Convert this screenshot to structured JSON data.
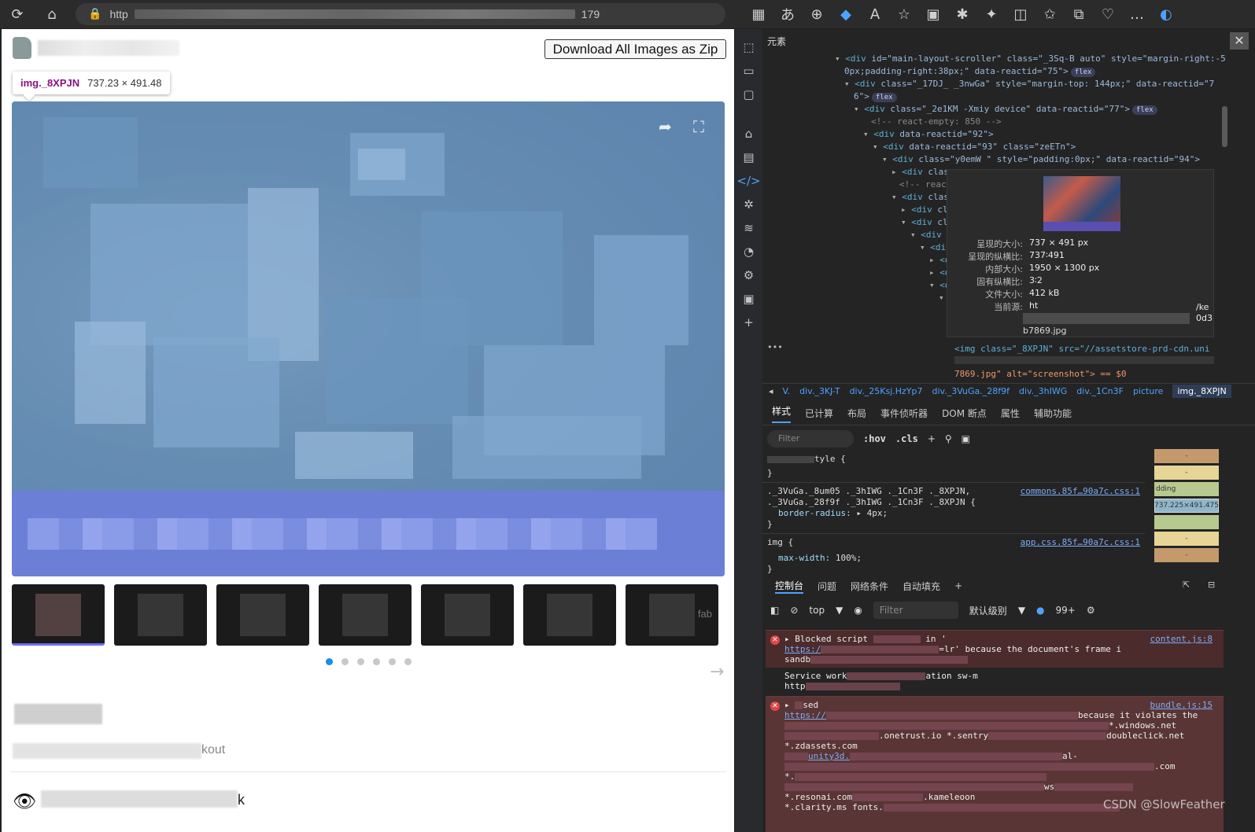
{
  "browser": {
    "address_suffix": "179",
    "address_prefix": "http"
  },
  "page": {
    "download_button": "Download All Images as Zip",
    "tooltip_tag": "img._8XPJN",
    "tooltip_size": "737.23 × 491.48",
    "thumb_fab_text": "fab",
    "subtitle_end": "kout",
    "views_end": "k"
  },
  "devtools": {
    "panel_title": "元素",
    "dom_lines": [
      {
        "indent": 92,
        "arrow": "▾",
        "tag": "div",
        "attrs": "id=\"main-layout-scroller\" class=\"_3Sq-B auto\" style=\"margin-right:-5",
        "badge": ""
      },
      {
        "indent": 104,
        "arrow": "",
        "tag": "",
        "attrs": "0px;padding-right:38px;\" data-reactid=\"75\">",
        "badge": "flex"
      },
      {
        "indent": 104,
        "arrow": "▾",
        "tag": "div",
        "attrs": "class=\"_17DJ_ _3nwGa\" style=\"margin-top: 144px;\" data-reactid=\"7",
        "badge": ""
      },
      {
        "indent": 116,
        "arrow": "",
        "tag": "",
        "attrs": "6\">",
        "badge": "flex"
      },
      {
        "indent": 116,
        "arrow": "▾",
        "tag": "div",
        "attrs": "class=\"_2e1KM -Xmiy device\" data-reactid=\"77\">",
        "badge": "flex"
      },
      {
        "indent": 138,
        "arrow": "",
        "tag": "",
        "attrs": "<!-- react-empty: 850 -->",
        "badge": ""
      },
      {
        "indent": 128,
        "arrow": "▾",
        "tag": "div",
        "attrs": "data-reactid=\"92\">",
        "badge": ""
      },
      {
        "indent": 140,
        "arrow": "▾",
        "tag": "div",
        "attrs": "data-reactid=\"93\" class=\"zeETn\">",
        "badge": ""
      },
      {
        "indent": 152,
        "arrow": "▾",
        "tag": "div",
        "attrs": "class=\"y0emW \" style=\"padding:0px;\" data-reactid=\"94\">",
        "badge": ""
      },
      {
        "indent": 164,
        "arrow": "▸",
        "tag": "div",
        "attrs": "clas",
        "badge": ""
      },
      {
        "indent": 174,
        "arrow": "",
        "tag": "",
        "attrs": "<!-- react",
        "badge": ""
      },
      {
        "indent": 164,
        "arrow": "▾",
        "tag": "div",
        "attrs": "clas",
        "badge": ""
      },
      {
        "indent": 176,
        "arrow": "▸",
        "tag": "div",
        "attrs": "cl",
        "badge": ""
      },
      {
        "indent": 176,
        "arrow": "▾",
        "tag": "div",
        "attrs": "cl",
        "badge": ""
      },
      {
        "indent": 188,
        "arrow": "▾",
        "tag": "div",
        "attrs": "",
        "badge": ""
      },
      {
        "indent": 200,
        "arrow": "▾",
        "tag": "div",
        "attrs": "",
        "badge": ""
      },
      {
        "indent": 212,
        "arrow": "▸",
        "tag": "d",
        "attrs": "",
        "badge": ""
      },
      {
        "indent": 212,
        "arrow": "▸",
        "tag": "d",
        "attrs": "",
        "badge": ""
      },
      {
        "indent": 212,
        "arrow": "▾",
        "tag": "d",
        "attrs": "",
        "badge": ""
      },
      {
        "indent": 224,
        "arrow": "▾",
        "tag": "",
        "attrs": "",
        "badge": ""
      }
    ],
    "img_line_1": "<img class=\"_8XPJN\" src=\"//assetstore-prd-cdn.uni",
    "img_line_3": "7869.jpg\" alt=\"screenshot\"> == $0",
    "img_tooltip": {
      "rows": [
        {
          "k": "呈现的大小:",
          "v": "737 × 491 px"
        },
        {
          "k": "呈现的纵横比:",
          "v": "737∶491"
        },
        {
          "k": "内部大小:",
          "v": "1950 × 1300 px"
        },
        {
          "k": "固有纵横比:",
          "v": "3∶2"
        },
        {
          "k": "文件大小:",
          "v": "412 kB"
        },
        {
          "k": "当前源:",
          "v": "ht"
        }
      ],
      "src_tail": "b7869.jpg",
      "src_end_1": "/ke",
      "src_end_2": "0d3"
    },
    "breadcrumbs": [
      "V.",
      "div._3KJ-T",
      "div._25Ksj.HzYp7",
      "div._3VuGa._28f9f",
      "div._3hIWG",
      "div._1Cn3F",
      "picture",
      "img._8XPJN"
    ],
    "tabs": [
      "样式",
      "已计算",
      "布局",
      "事件侦听器",
      "DOM 断点",
      "属性",
      "辅助功能"
    ],
    "styles_filter_placeholder": "Filter",
    "hov": ":hov",
    "cls": ".cls",
    "styles": {
      "rule1_tail": "tyle {",
      "rule1_close": "}",
      "rule2_sel1": "._3VuGa._8um05 ._3hIWG ._1Cn3F ._8XPJN,",
      "rule2_sel2": "._3VuGa._28f9f ._3hIWG ._1Cn3F ._8XPJN {",
      "rule2_prop": "border-radius:",
      "rule2_val": "▸ 4px;",
      "rule2_src": "commons.85f…90a7c.css:1",
      "rule3_sel": "img {",
      "rule3_prop": "max-width:",
      "rule3_val": "100%;",
      "rule3_src": "app.css.85f…90a7c.css:1"
    },
    "box_model": {
      "margin": "-",
      "border": "-",
      "padding": "dding",
      "content": "737.225×491.475"
    },
    "console_tabs": [
      "控制台",
      "问题",
      "网络条件",
      "自动填充"
    ],
    "console_top": "top",
    "console_filter": "Filter",
    "console_level": "默认级别",
    "console_count": "99+",
    "errors": [
      {
        "text": "Blocked script",
        "mid": "in '",
        "end": "=lr' because the document's frame i",
        "link": "https:/",
        "src": "content.js:8",
        "line3": "sandb"
      },
      {
        "text": "Service work",
        "mid": "ation sw-m",
        "end": "",
        "link": "http",
        "src": "",
        "line3": ""
      }
    ],
    "error2": {
      "head": "sed",
      "src": "bundle.js:15",
      "link": "https://",
      "l1": "because it violates the",
      "l2": "*.windows.net",
      "l3": "doubleclick.net",
      "l4": ".onetrust.io *.sentry",
      "l5": "*.zdassets.com",
      "l6": "unity3d.",
      "l7": "al-",
      "l8": "*.resonai.com",
      "l9": ".kameleoon",
      "l10": "*.clarity.ms fonts.",
      "l11": "*.",
      "l12": ".com",
      "l13": "ws"
    },
    "watermark": "CSDN @SlowFeather"
  }
}
